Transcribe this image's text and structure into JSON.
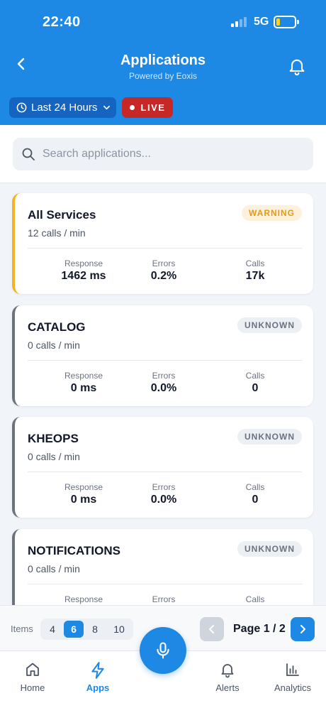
{
  "status_bar": {
    "time": "22:40",
    "network": "5G"
  },
  "header": {
    "title": "Applications",
    "subtitle": "Powered by Eoxis",
    "time_range_label": "Last 24 Hours",
    "live_label": "LIVE"
  },
  "search": {
    "placeholder": "Search applications...",
    "value": ""
  },
  "apps": [
    {
      "name": "All Services",
      "rate": "12 calls / min",
      "status": "WARNING",
      "response_label": "Response",
      "response": "1462 ms",
      "errors_label": "Errors",
      "errors": "0.2%",
      "calls_label": "Calls",
      "calls": "17k"
    },
    {
      "name": "CATALOG",
      "rate": "0 calls / min",
      "status": "UNKNOWN",
      "response_label": "Response",
      "response": "0 ms",
      "errors_label": "Errors",
      "errors": "0.0%",
      "calls_label": "Calls",
      "calls": "0"
    },
    {
      "name": "KHEOPS",
      "rate": "0 calls / min",
      "status": "UNKNOWN",
      "response_label": "Response",
      "response": "0 ms",
      "errors_label": "Errors",
      "errors": "0.0%",
      "calls_label": "Calls",
      "calls": "0"
    },
    {
      "name": "NOTIFICATIONS",
      "rate": "0 calls / min",
      "status": "UNKNOWN",
      "response_label": "Response",
      "response": "",
      "errors_label": "Errors",
      "errors": "",
      "calls_label": "Calls",
      "calls": ""
    }
  ],
  "pagination": {
    "items_label": "Items",
    "page_sizes": [
      "4",
      "6",
      "8",
      "10"
    ],
    "selected_page_size": "6",
    "page_label": "Page 1 / 2"
  },
  "tabs": [
    {
      "label": "Home",
      "icon": "home-icon"
    },
    {
      "label": "Apps",
      "icon": "lightning-icon",
      "active": true
    },
    {
      "label": "Alerts",
      "icon": "bell-icon"
    },
    {
      "label": "Analytics",
      "icon": "bar-chart-icon"
    }
  ],
  "colors": {
    "primary": "#1e88e5",
    "live": "#c62828",
    "warning": "#f4b223",
    "unknown": "#6b7280"
  }
}
